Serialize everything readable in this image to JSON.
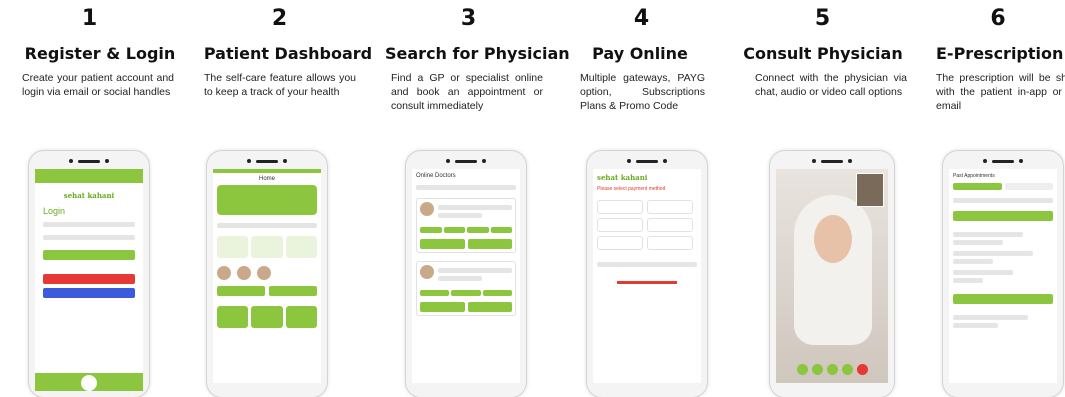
{
  "steps": [
    {
      "num": "1",
      "title": "Register & Login",
      "desc": "Create your patient account and login via email or social handles"
    },
    {
      "num": "2",
      "title": "Patient Dashboard",
      "desc": "The self-care feature allows you to keep a track of your health"
    },
    {
      "num": "3",
      "title": "Search for Physician",
      "desc": "Find a GP or specialist online and book an appointment or consult immediately"
    },
    {
      "num": "4",
      "title": "Pay Online",
      "desc": "Multiple gateways, PAYG option, Subscriptions Plans & Promo Code"
    },
    {
      "num": "5",
      "title": "Consult Physician",
      "desc": "Connect with the physician via chat, audio or video call options"
    },
    {
      "num": "6",
      "title": "E-Prescription",
      "desc": "The prescription will be shared with the patient in-app or over email"
    }
  ],
  "screens": {
    "login": {
      "logo": "sehat kahani",
      "heading": "Login"
    },
    "dashboard": {
      "header": "Home"
    },
    "search": {
      "header": "Online Doctors"
    },
    "pay": {
      "logo": "sehat kahani",
      "heading": "Please select payment method"
    },
    "prescription": {
      "header": "Past Appointments"
    }
  },
  "colors": {
    "brand_green": "#8cc63f",
    "accent_red": "#e53935",
    "accent_blue": "#3b5bdb"
  }
}
